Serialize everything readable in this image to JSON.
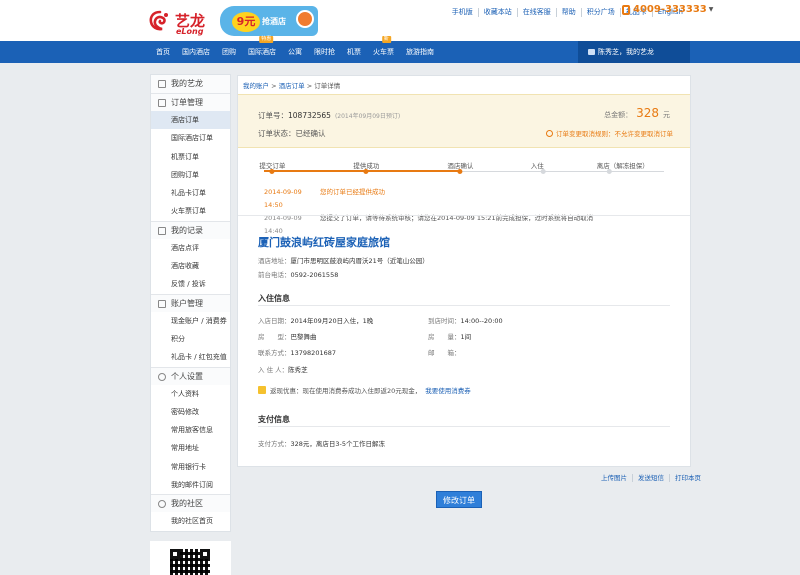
{
  "brand": {
    "cn": "艺龙",
    "en": "eLong"
  },
  "promo": {
    "price": "9元",
    "text": "抢酒店"
  },
  "toplinks": [
    "手机版",
    "收藏本站",
    "在线客服",
    "帮助",
    "积分广场",
    "礼品卡",
    "English"
  ],
  "hotline": "4009-333333",
  "nav": {
    "items": [
      {
        "label": "首页",
        "badge": ""
      },
      {
        "label": "国内酒店",
        "badge": ""
      },
      {
        "label": "团购",
        "badge": ""
      },
      {
        "label": "国际酒店",
        "badge": "特惠"
      },
      {
        "label": "公寓",
        "badge": ""
      },
      {
        "label": "限时抢",
        "badge": ""
      },
      {
        "label": "机票",
        "badge": ""
      },
      {
        "label": "火车票",
        "badge": "新"
      },
      {
        "label": "旅游指南",
        "badge": ""
      }
    ],
    "user_greeting": "陈秀芝，我的艺龙"
  },
  "sidebar": {
    "sections": [
      {
        "title": "我的艺龙",
        "items": []
      },
      {
        "title": "订单管理",
        "items": [
          "酒店订单",
          "国际酒店订单",
          "机票订单",
          "团购订单",
          "礼品卡订单",
          "火车票订单"
        ]
      },
      {
        "title": "我的记录",
        "items": [
          "酒店点评",
          "酒店收藏",
          "反馈 / 投诉"
        ]
      },
      {
        "title": "账户管理",
        "items": [
          "现金账户 / 消费券",
          "积分",
          "礼品卡 / 红包充值"
        ]
      },
      {
        "title": "个人设置",
        "items": [
          "个人资料",
          "密码修改",
          "常用旅客信息",
          "常用地址",
          "常用银行卡",
          "我的邮件订阅"
        ]
      },
      {
        "title": "我的社区",
        "items": [
          "我的社区首页"
        ]
      }
    ],
    "active_item": "酒店订单"
  },
  "breadcrumb": {
    "a": "我的账户",
    "b": "酒店订单",
    "c": "订单详情",
    "sep": ">"
  },
  "order": {
    "no_label": "订单号：",
    "no": "108732565",
    "date_note": "(2014年09月09日预订)",
    "status_label": "订单状态：",
    "status": "已经确认",
    "total_label": "总金额：",
    "total": "328",
    "currency": "元",
    "policy_a": "订单变更取消规则：",
    "policy_b": "不允许变更取消订单"
  },
  "progress": {
    "fill_fraction": 0.49,
    "steps": [
      {
        "label": "提交订单",
        "done": true
      },
      {
        "label": "提供成功",
        "done": true
      },
      {
        "label": "酒店确认",
        "done": true
      },
      {
        "label": "入住",
        "done": false
      },
      {
        "label": "离店（解冻担保）",
        "done": false
      }
    ]
  },
  "log": [
    {
      "time": "2014-09-09 14:50",
      "msg": "您的订单已经提供成功",
      "hl": true
    },
    {
      "time": "2014-09-09 14:40",
      "msg": "您提交了订单，请等待系统审核；请您在2014-09-09 15:21前完成担保，过时系统将自动取消",
      "hl": false
    }
  ],
  "hotel": {
    "name": "厦门鼓浪屿红砖屋家庭旅馆",
    "addr_label": "酒店地址：",
    "addr": "厦门市思明区鼓浪屿内厝沃21号（近笔山公园）",
    "tel_label": "前台电话：",
    "tel": "0592-2061558"
  },
  "checkin": {
    "title": "入住信息",
    "date_label": "入店日期：",
    "date": "2014年09月20日入住，1晚",
    "arrive_label": "到店时间：",
    "arrive": "14:00--20:00",
    "room_label": "房　　型：",
    "room": "巴黎舞曲",
    "qty_label": "房　　量：",
    "qty": "1间",
    "contact_label": "联系方式：",
    "contact": "13798201687",
    "mail_label": "邮　　箱：",
    "mail": "",
    "guest_label": "入 住 人：",
    "guest": "陈秀芝"
  },
  "tip": {
    "label": "返现优惠：",
    "text": "现在使用消费券成功入住即返20元现金，",
    "link": "我要使用消费券"
  },
  "payment": {
    "title": "支付信息",
    "label": "支付方式：",
    "value": "328元，离店日3-5个工作日解冻"
  },
  "footer_links": [
    "上传图片",
    "发送短信",
    "打印本页"
  ],
  "modify_button": "修改订单"
}
